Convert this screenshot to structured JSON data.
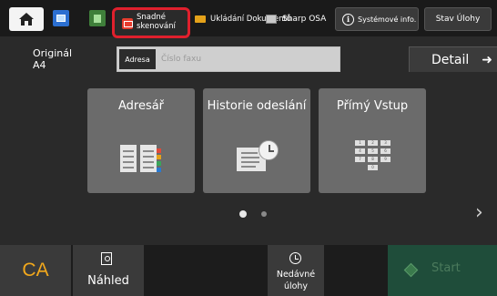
{
  "topbar": {
    "snadne": "Snadné skenování",
    "ukladani": "Ukládání Dokumentů",
    "sharp": "Sharp OSA",
    "sysinfo": "Systémové info.",
    "stav": "Stav Úlohy"
  },
  "original": {
    "label": "Originál",
    "size": "A4"
  },
  "address": {
    "tag": "Adresa",
    "placeholder": "Číslo faxu"
  },
  "detail": {
    "label": "Detail",
    "arrow": "➜"
  },
  "cards": {
    "adresar": "Adresář",
    "historie": "Historie odeslání",
    "primy": "Přímý Vstup"
  },
  "keypad": [
    "1",
    "2",
    "3",
    "4",
    "5",
    "6",
    "7",
    "8",
    "9",
    "0"
  ],
  "pager": {
    "current": 1,
    "total": 2
  },
  "bottom": {
    "ca": "CA",
    "nahled": "Náhled",
    "nedavne": "Nedávné úlohy",
    "start": "Start"
  },
  "colors": {
    "highlight": "#e0202d",
    "ca": "#f2a81c",
    "start_bg": "#1f4d3a"
  }
}
